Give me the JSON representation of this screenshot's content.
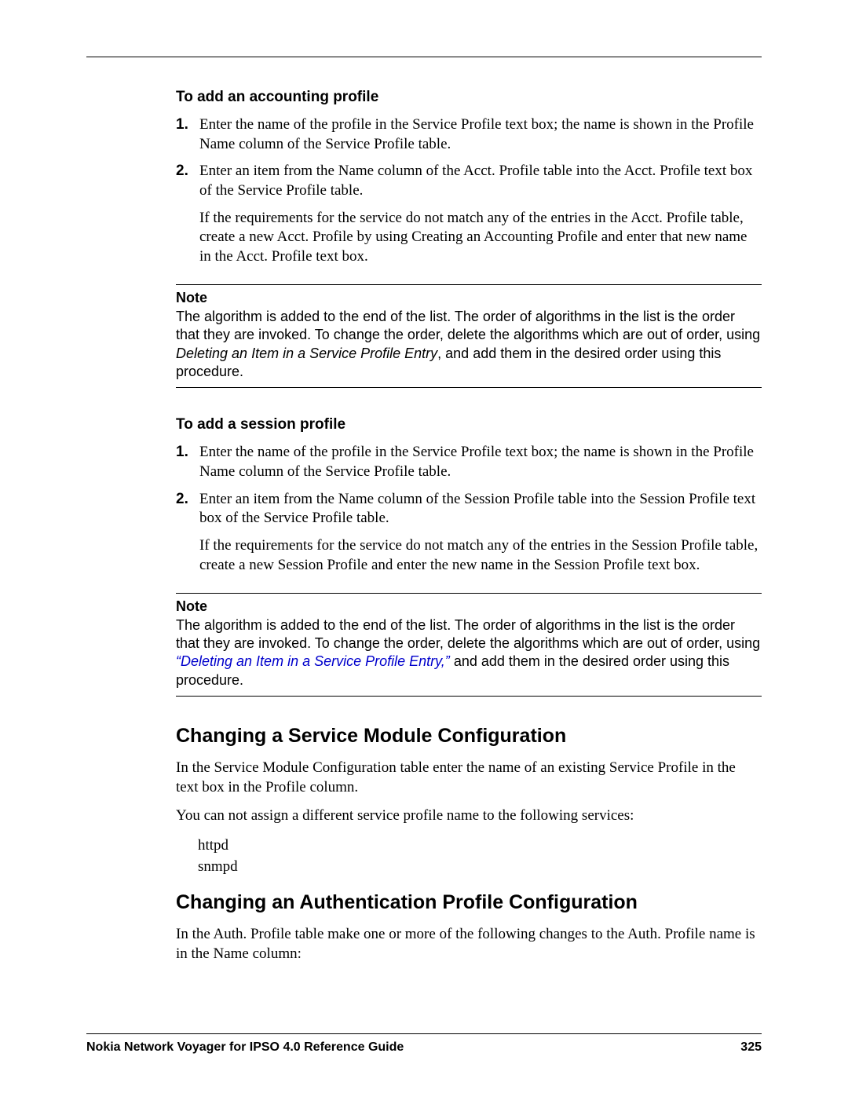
{
  "section1": {
    "heading": "To add an accounting profile",
    "steps": [
      {
        "num": "1.",
        "text": "Enter the name of the profile in the Service Profile text box; the name is shown in the Profile Name column of the Service Profile table."
      },
      {
        "num": "2.",
        "text": "Enter an item from the Name column of the Acct. Profile table into the Acct. Profile text box of the Service Profile table.",
        "follow": "If the requirements for the service do not match any of the entries in the Acct. Profile table, create a new Acct. Profile by using Creating an Accounting Profile and enter that new name in the Acct. Profile text box."
      }
    ]
  },
  "note1": {
    "label": "Note",
    "pre": "The algorithm is added to the end of the list. The order of algorithms in the list is the order that they are invoked. To change the order, delete the algorithms which are out of order, using ",
    "italic": "Deleting an Item in a Service Profile Entry",
    "post": ", and add them in the desired order using this procedure."
  },
  "section2": {
    "heading": "To add a session profile",
    "steps": [
      {
        "num": "1.",
        "text": "Enter the name of the profile in the Service Profile text box; the name is shown in the Profile Name column of the Service Profile table."
      },
      {
        "num": "2.",
        "text": "Enter an item from the Name column of the Session Profile table into the Session Profile text box of the Service Profile table.",
        "follow": "If the requirements for the service do not match any of the entries in the Session Profile table, create a new Session Profile and enter the new name in the Session Profile text box."
      }
    ]
  },
  "note2": {
    "label": "Note",
    "pre": "The algorithm is added to the end of the list. The order of algorithms in the list is the order that they are invoked. To change the order, delete the algorithms which are out of order, using ",
    "link": "“Deleting an Item in a Service Profile Entry,”",
    "post": " and add them in the desired order using this procedure."
  },
  "section3": {
    "heading": "Changing a Service Module Configuration",
    "para1": "In the Service Module Configuration table enter the name of an existing Service Profile in the text box in the Profile column.",
    "para2": "You can not assign a different service profile name to the following services:",
    "items": [
      "httpd",
      "snmpd"
    ]
  },
  "section4": {
    "heading": "Changing an Authentication Profile Configuration",
    "para1": "In the Auth. Profile table make one or more of the following changes to the Auth. Profile name is in the Name column:"
  },
  "footer": {
    "title": "Nokia Network Voyager for IPSO 4.0 Reference Guide",
    "page": "325"
  }
}
